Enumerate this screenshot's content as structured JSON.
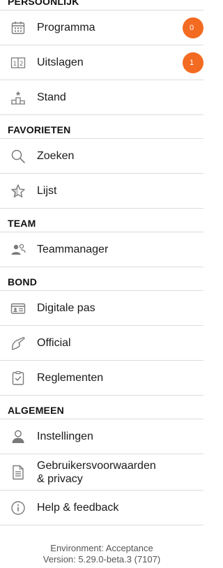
{
  "colors": {
    "badge": "#f36b21",
    "icon": "#7a7a7a",
    "divider": "#dcdcdc"
  },
  "sections": {
    "personal": {
      "title": "PERSOONLIJK",
      "items": [
        {
          "label": "Programma",
          "icon": "calendar-icon",
          "badge": "0"
        },
        {
          "label": "Uitslagen",
          "icon": "scoreboard-icon",
          "badge": "1"
        },
        {
          "label": "Stand",
          "icon": "podium-icon"
        }
      ]
    },
    "favorites": {
      "title": "FAVORIETEN",
      "items": [
        {
          "label": "Zoeken",
          "icon": "search-icon"
        },
        {
          "label": "Lijst",
          "icon": "star-icon"
        }
      ]
    },
    "team": {
      "title": "TEAM",
      "items": [
        {
          "label": "Teammanager",
          "icon": "users-icon"
        }
      ]
    },
    "bond": {
      "title": "BOND",
      "items": [
        {
          "label": "Digitale pas",
          "icon": "id-card-icon"
        },
        {
          "label": "Official",
          "icon": "whistle-icon"
        },
        {
          "label": "Reglementen",
          "icon": "clipboard-check-icon"
        }
      ]
    },
    "general": {
      "title": "ALGEMEEN",
      "items": [
        {
          "label": "Instellingen",
          "icon": "profile-settings-icon"
        },
        {
          "label_line1": "Gebruikersvoorwaarden",
          "label_line2": "& privacy",
          "icon": "document-icon"
        },
        {
          "label": "Help & feedback",
          "icon": "info-icon"
        }
      ]
    }
  },
  "footer": {
    "environment": "Environment: Acceptance",
    "version": "Version: 5.29.0-beta.3 (7107)"
  }
}
